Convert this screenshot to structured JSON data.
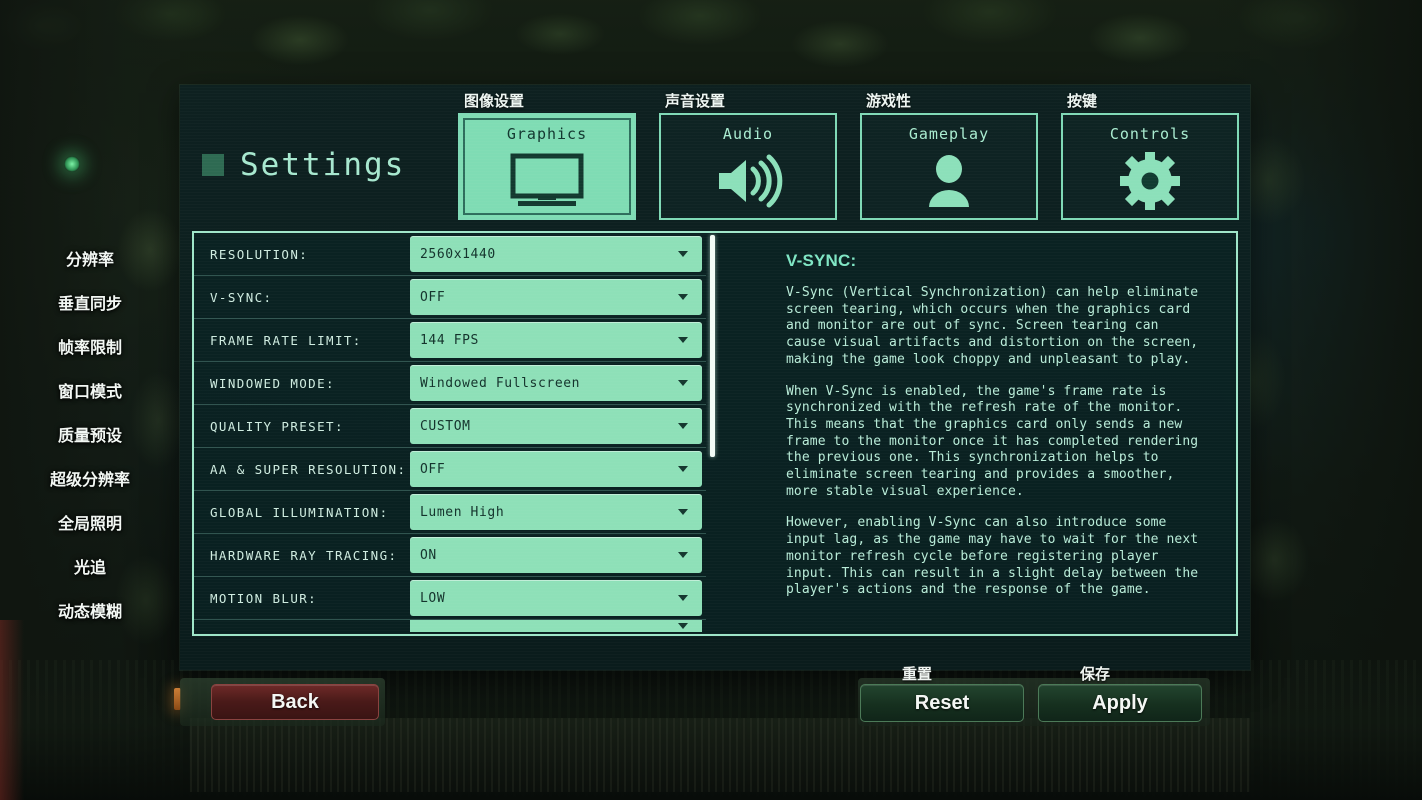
{
  "header": {
    "title": "Settings",
    "title_icon": "square-icon"
  },
  "tabs": [
    {
      "label": "Graphics",
      "cn": "图像设置",
      "icon": "monitor-icon",
      "selected": true
    },
    {
      "label": "Audio",
      "cn": "声音设置",
      "icon": "speaker-icon",
      "selected": false
    },
    {
      "label": "Gameplay",
      "cn": "游戏性",
      "icon": "person-icon",
      "selected": false
    },
    {
      "label": "Controls",
      "cn": "按键",
      "icon": "gear-icon",
      "selected": false
    }
  ],
  "side_labels": [
    "分辨率",
    "垂直同步",
    "帧率限制",
    "窗口模式",
    "质量预设",
    "超级分辨率",
    "全局照明",
    "光追",
    "动态模糊"
  ],
  "settings_rows": [
    {
      "label": "RESOLUTION:",
      "value": "2560x1440"
    },
    {
      "label": "V-SYNC:",
      "value": "OFF"
    },
    {
      "label": "FRAME RATE LIMIT:",
      "value": "144 FPS"
    },
    {
      "label": "WINDOWED MODE:",
      "value": "Windowed Fullscreen"
    },
    {
      "label": "QUALITY PRESET:",
      "value": "CUSTOM"
    },
    {
      "label": "AA & SUPER RESOLUTION:",
      "value": "OFF"
    },
    {
      "label": "GLOBAL ILLUMINATION:",
      "value": "Lumen High"
    },
    {
      "label": "HARDWARE RAY TRACING:",
      "value": "ON"
    },
    {
      "label": "MOTION BLUR:",
      "value": "LOW"
    }
  ],
  "description": {
    "title": "V-SYNC:",
    "paragraphs": [
      "V-Sync (Vertical Synchronization) can help eliminate\nscreen tearing, which occurs when the graphics card\nand monitor are out of sync. Screen tearing can\ncause visual artifacts and distortion on the screen,\nmaking the game look choppy and unpleasant to play.",
      "When V-Sync is enabled, the game's frame rate is\nsynchronized with the refresh rate of the monitor.\nThis means that the graphics card only sends a new\nframe to the monitor once it has completed rendering\nthe previous one. This synchronization helps to\neliminate screen tearing and provides a smoother,\nmore stable visual experience.",
      "However, enabling V-Sync can also introduce some\ninput lag, as the game may have to wait for the next\nmonitor refresh cycle before registering player\ninput. This can result in a slight delay between the\nplayer's actions and the response of the game."
    ]
  },
  "buttons": {
    "back": "Back",
    "reset": "Reset",
    "apply": "Apply",
    "reset_cn": "重置",
    "apply_cn": "保存"
  },
  "colors": {
    "accent_mint": "#8ee0b8",
    "panel_bg": "#0d2121",
    "text_mint": "#b9ecd8",
    "back_red": "#4a1a19",
    "action_green": "#16301f"
  }
}
